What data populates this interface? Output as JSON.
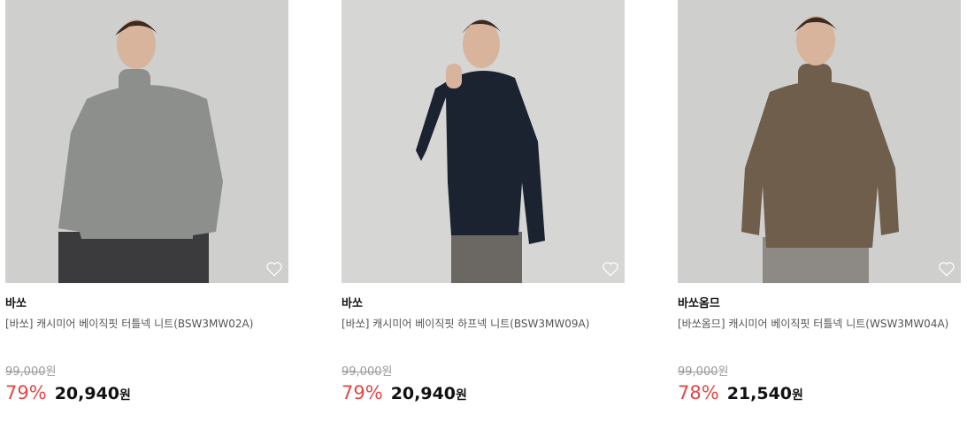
{
  "products": [
    {
      "brand": "바쏘",
      "name": "[바쏘] 캐시미어 베이직핏 터틀넥 니트(BSW3MW02A)",
      "original_price": "99,000",
      "original_unit": "원",
      "discount": "79%",
      "sale_price": "20,940",
      "sale_unit": "원",
      "sweater_color": "#8c8f8b",
      "background_color": "#cfcfcd",
      "style": "turtleneck",
      "favorite_icon": "heart-outline-icon"
    },
    {
      "brand": "바쏘",
      "name": "[바쏘] 캐시미어 베이직핏 하프넥 니트(BSW3MW09A)",
      "original_price": "99,000",
      "original_unit": "원",
      "discount": "79%",
      "sale_price": "20,940",
      "sale_unit": "원",
      "sweater_color": "#1b2230",
      "background_color": "#d6d6d4",
      "style": "halfneck",
      "favorite_icon": "heart-outline-icon"
    },
    {
      "brand": "바쏘옴므",
      "name": "[바쏘옴므] 캐시미어 베이직핏 터틀넥 니트(WSW3MW04A)",
      "original_price": "99,000",
      "original_unit": "원",
      "discount": "78%",
      "sale_price": "21,540",
      "sale_unit": "원",
      "sweater_color": "#6e5e4b",
      "background_color": "#cfcfcd",
      "style": "turtleneck",
      "favorite_icon": "heart-outline-icon"
    }
  ]
}
